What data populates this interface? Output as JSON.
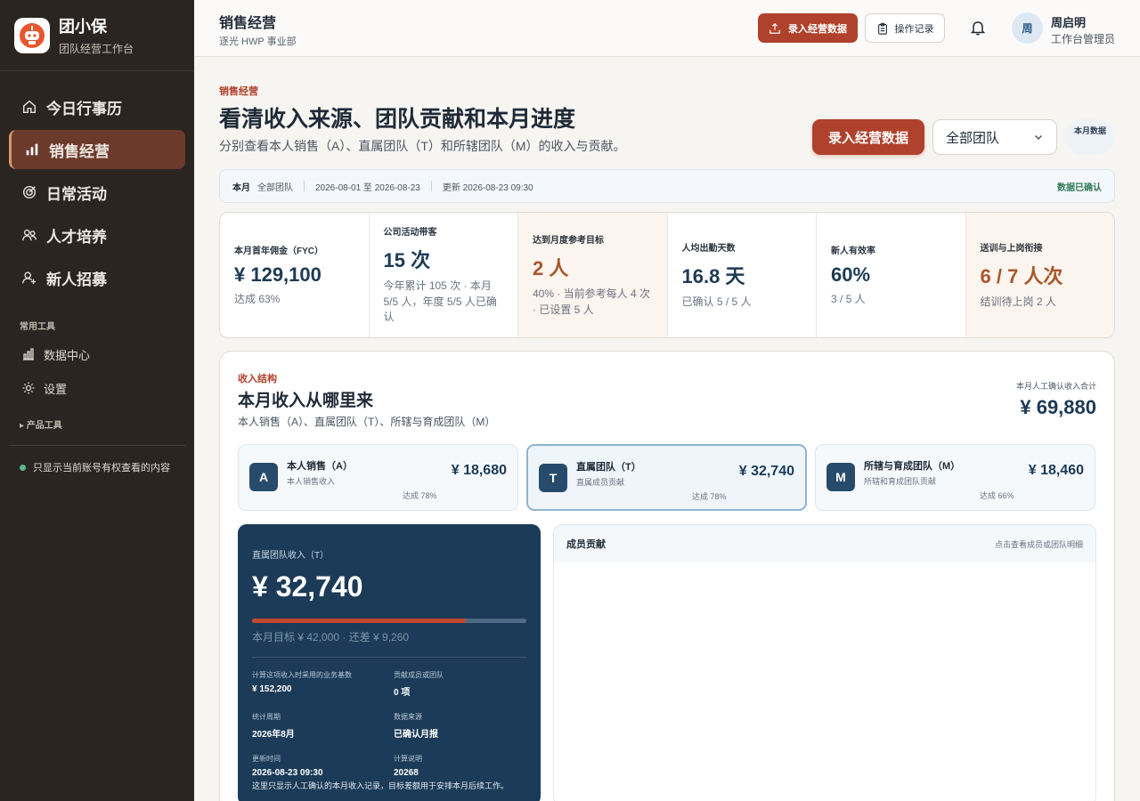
{
  "brand": {
    "name": "团小保",
    "subtitle": "团队经营工作台"
  },
  "nav": [
    {
      "label": "今日行事历",
      "icon": "home-icon"
    },
    {
      "label": "销售经营",
      "icon": "bar-chart-icon",
      "active": true
    },
    {
      "label": "日常活动",
      "icon": "target-icon"
    },
    {
      "label": "人才培养",
      "icon": "people-icon"
    },
    {
      "label": "新人招募",
      "icon": "user-plus-icon"
    }
  ],
  "tools": {
    "section_label": "常用工具",
    "items": [
      {
        "label": "数据中心",
        "icon": "chart-icon"
      },
      {
        "label": "设置",
        "icon": "gear-icon"
      }
    ],
    "product_tools_label": "▸ 产品工具"
  },
  "permission_note": "只显示当前账号有权查看的内容",
  "topbar": {
    "title": "销售经营",
    "subtitle": "逐光 HWP 事业部",
    "primary_button": "录入经营数据",
    "log_button": "操作记录",
    "user": {
      "avatar": "周",
      "name": "周启明",
      "role": "工作台管理员"
    }
  },
  "header": {
    "eyebrow": "销售经营",
    "title": "看清收入来源、团队贡献和本月进度",
    "description": "分别查看本人销售（A）、直属团队（T）和所辖团队（M）的收入与贡献。",
    "primary_button": "录入经营数据",
    "team_select": "全部团队",
    "period_chip": "本月数据"
  },
  "info_bar": {
    "period": "本月",
    "scope": "全部团队",
    "range": "2026-08-01 至 2026-08-23",
    "updated": "更新 2026-08-23 09:30",
    "status": "数据已确认"
  },
  "kpis": [
    {
      "label": "本月首年佣金（FYC）",
      "value": "¥ 129,100",
      "sub": "达成 63%"
    },
    {
      "label": "公司活动带客",
      "value": "15 次",
      "sub": "今年累计 105 次 · 本月 5/5 人，年度 5/5 人已确认"
    },
    {
      "label": "达到月度参考目标",
      "value": "2 人",
      "sub": "40% · 当前参考每人 4 次 · 已设置 5 人"
    },
    {
      "label": "人均出勤天数",
      "value": "16.8 天",
      "sub": "已确认 5 / 5 人"
    },
    {
      "label": "新人有效率",
      "value": "60%",
      "sub": "3 / 5 人"
    },
    {
      "label": "送训与上岗衔接",
      "value": "6 / 7 人次",
      "sub": "结训待上岗 2 人"
    }
  ],
  "income": {
    "eyebrow": "收入结构",
    "title": "本月收入从哪里来",
    "description": "本人销售（A）、直属团队（T）、所辖与育成团队（M）",
    "total_label": "本月人工确认收入合计",
    "total": "¥ 69,880",
    "sources": [
      {
        "badge": "A",
        "name": "本人销售（A）",
        "desc": "本人销售收入",
        "amount": "¥ 18,680",
        "rate": "达成 78%"
      },
      {
        "badge": "T",
        "name": "直属团队（T）",
        "desc": "直属成员贡献",
        "amount": "¥ 32,740",
        "rate": "达成 78%",
        "active": true
      },
      {
        "badge": "M",
        "name": "所辖与育成团队（M）",
        "desc": "所辖和育成团队贡献",
        "amount": "¥ 18,460",
        "rate": "达成 66%"
      }
    ]
  },
  "t_panel": {
    "label": "直属团队收入（T）",
    "amount": "¥ 32,740",
    "progress": 0.78,
    "target_text": "本月目标 ¥ 42,000 · 还差 ¥ 9,260",
    "fields": [
      {
        "k": "计算这项收入时采用的业务基数",
        "v": "¥ 152,200"
      },
      {
        "k": "贡献成员或团队",
        "v": "0 项"
      },
      {
        "k": "统计周期",
        "v": "2026年8月"
      },
      {
        "k": "数据来源",
        "v": "已确认月报"
      },
      {
        "k": "更新时间",
        "v": "2026-08-23 09:30"
      },
      {
        "k": "计算说明",
        "v": "20268"
      }
    ],
    "note": "这里只显示人工确认的本月收入记录，目标差额用于安排本月后续工作。"
  },
  "member_panel": {
    "title": "成员贡献",
    "hint": "点击查看成员或团队明细"
  },
  "colors": {
    "accent": "#b0412c",
    "sidebar": "#2b2521",
    "navy": "#1b3b58",
    "success": "#2f7a55"
  }
}
